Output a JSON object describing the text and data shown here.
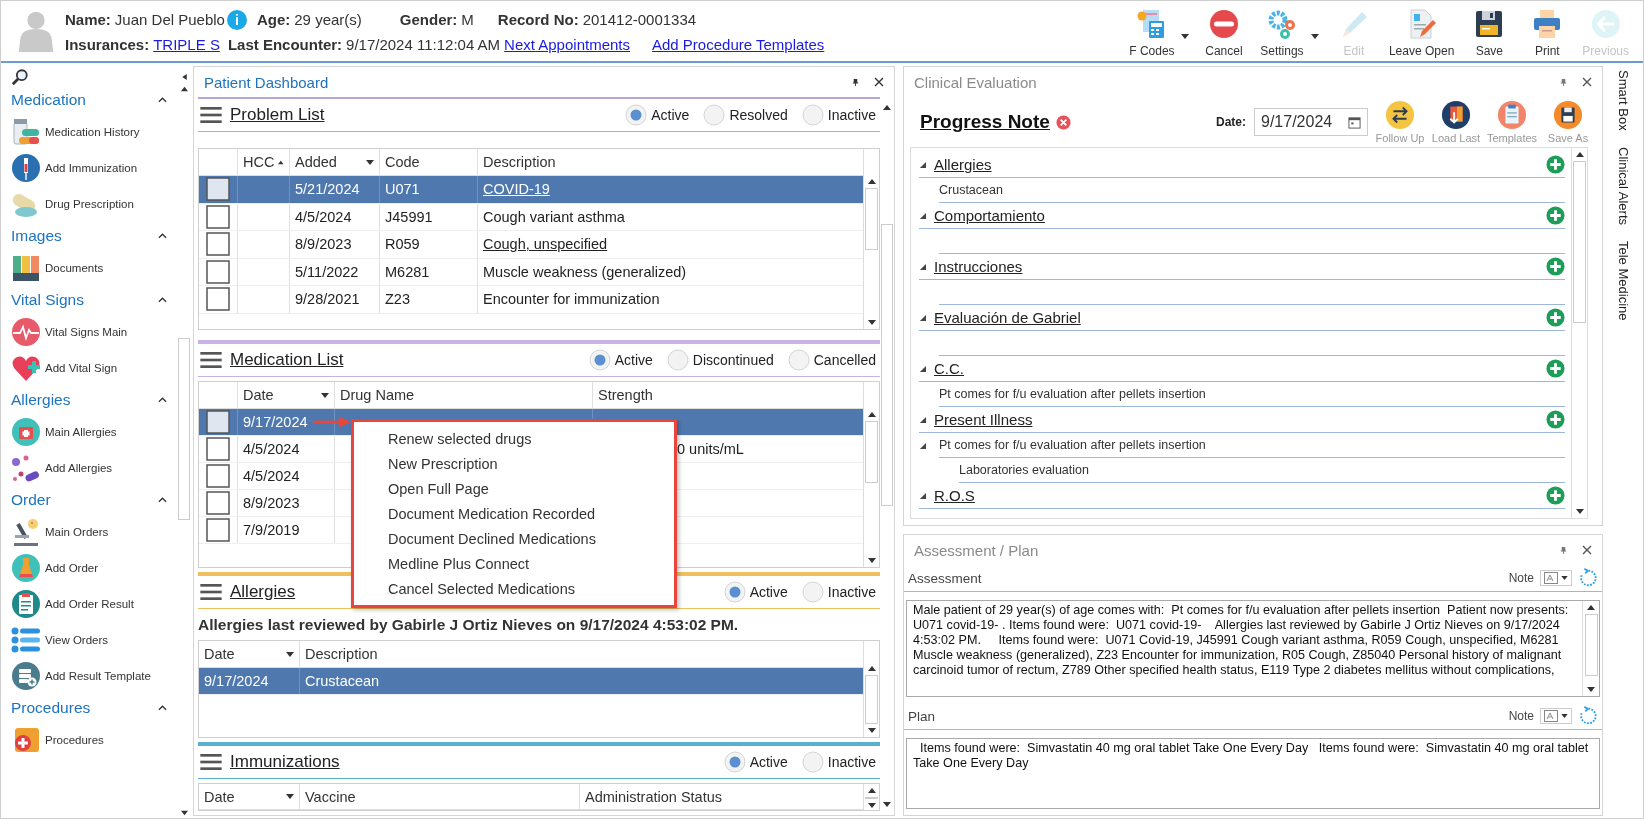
{
  "header": {
    "name_label": "Name:",
    "name": "Juan Del Pueblo",
    "info_icon": "i",
    "age_label": "Age:",
    "age": "29 year(s)",
    "gender_label": "Gender:",
    "gender": "M",
    "record_label": "Record No:",
    "record": "201412-0001334",
    "insurances_label": "Insurances:",
    "insurance": "TRIPLE S",
    "last_encounter_label": "Last Encounter:",
    "last_encounter": "9/17/2024 11:12:04 AM",
    "links": [
      "Next Appointments",
      "Add Procedure Templates"
    ]
  },
  "toolbar": [
    {
      "label": "F Codes",
      "kind": "fcodes",
      "dropdown": true,
      "disabled": false
    },
    {
      "label": "Cancel",
      "kind": "cancel",
      "dropdown": false,
      "disabled": false
    },
    {
      "label": "Settings",
      "kind": "settings",
      "dropdown": true,
      "disabled": false
    },
    {
      "label": "Edit",
      "kind": "edit",
      "dropdown": false,
      "disabled": true
    },
    {
      "label": "Leave Open",
      "kind": "leave",
      "dropdown": false,
      "disabled": false
    },
    {
      "label": "Save",
      "kind": "save",
      "dropdown": false,
      "disabled": false
    },
    {
      "label": "Print",
      "kind": "print",
      "dropdown": false,
      "disabled": false
    },
    {
      "label": "Previous",
      "kind": "previous",
      "dropdown": false,
      "disabled": true
    }
  ],
  "sidebar": {
    "sections": [
      {
        "title": "Medication",
        "expanded": true,
        "items": [
          {
            "label": "Medication History",
            "kind": "bottle"
          },
          {
            "label": "Add Immunization",
            "kind": "syringe"
          },
          {
            "label": "Drug Prescription",
            "kind": "capsule"
          }
        ]
      },
      {
        "title": "Images",
        "expanded": true,
        "items": [
          {
            "label": "Documents",
            "kind": "binders"
          }
        ]
      },
      {
        "title": "Vital Signs",
        "expanded": true,
        "items": [
          {
            "label": "Vital Signs Main",
            "kind": "pulse"
          },
          {
            "label": "Add Vital Sign",
            "kind": "heartplus"
          }
        ]
      },
      {
        "title": "Allergies",
        "expanded": true,
        "items": [
          {
            "label": "Main Allergies",
            "kind": "medkit"
          },
          {
            "label": "Add Allergies",
            "kind": "pills"
          }
        ]
      },
      {
        "title": "Order",
        "expanded": true,
        "items": [
          {
            "label": "Main Orders",
            "kind": "microscope"
          },
          {
            "label": "Add Order",
            "kind": "flask"
          },
          {
            "label": "Add Order Result",
            "kind": "clipboard"
          },
          {
            "label": "View Orders",
            "kind": "list"
          },
          {
            "label": "Add Result Template",
            "kind": "database"
          }
        ]
      },
      {
        "title": "Procedures",
        "expanded": true,
        "items": [
          {
            "label": "Procedures",
            "kind": "box"
          }
        ]
      }
    ]
  },
  "dashboard": {
    "title": "Patient Dashboard",
    "panels": [
      {
        "kind": "problems",
        "title": "Problem List",
        "color": "#b9a6d9",
        "filters": [
          {
            "label": "Active",
            "selected": true
          },
          {
            "label": "Resolved",
            "selected": false
          },
          {
            "label": "Inactive",
            "selected": false
          }
        ],
        "columns": [
          {
            "label": "HCC",
            "sort_up": true
          },
          {
            "label": "Added",
            "filter": true
          },
          {
            "label": "Code"
          },
          {
            "label": "Description"
          }
        ],
        "rows": [
          {
            "selected": true,
            "checked": false,
            "cells": [
              null,
              {
                "text": "5/21/2024"
              },
              {
                "text": "U071"
              },
              {
                "text": "COVID-19",
                "link": true
              }
            ]
          },
          {
            "selected": false,
            "checked": false,
            "cells": [
              null,
              {
                "text": "4/5/2024"
              },
              {
                "text": "J45991"
              },
              {
                "text": "Cough variant asthma"
              }
            ]
          },
          {
            "selected": false,
            "checked": false,
            "cells": [
              null,
              {
                "text": "8/9/2023"
              },
              {
                "text": "R059"
              },
              {
                "text": "Cough, unspecified",
                "link": true
              }
            ]
          },
          {
            "selected": false,
            "checked": false,
            "cells": [
              null,
              {
                "text": "5/11/2022"
              },
              {
                "text": "M6281"
              },
              {
                "text": "Muscle weakness (generalized)"
              }
            ]
          },
          {
            "selected": false,
            "checked": false,
            "cells": [
              null,
              {
                "text": "9/28/2021"
              },
              {
                "text": "Z23"
              },
              {
                "text": "Encounter for immunization"
              }
            ]
          }
        ]
      },
      {
        "kind": "medications",
        "title": "Medication List",
        "color": "#c9b3e6",
        "filters": [
          {
            "label": "Active",
            "selected": true
          },
          {
            "label": "Discontinued",
            "selected": false
          },
          {
            "label": "Cancelled",
            "selected": false
          }
        ],
        "columns": [
          {
            "label": "Date",
            "filter": true
          },
          {
            "label": "Drug Name"
          },
          {
            "label": "Strength"
          }
        ],
        "rows": [
          {
            "selected": true,
            "checked": false,
            "cells": [
              {
                "text": "9/17/2024"
              }
            ]
          },
          {
            "selected": false,
            "checked": false,
            "cells": [
              {
                "text": "4/5/2024"
              },
              null,
              {
                "text": "0 units/mL"
              }
            ]
          },
          {
            "selected": false,
            "checked": false,
            "cells": [
              {
                "text": "4/5/2024"
              }
            ]
          },
          {
            "selected": false,
            "checked": false,
            "cells": [
              {
                "text": "8/9/2023"
              }
            ]
          },
          {
            "selected": false,
            "checked": false,
            "cells": [
              {
                "text": "7/9/2019"
              }
            ]
          }
        ]
      },
      {
        "kind": "allergies",
        "title": "Allergies",
        "color": "#f0c060",
        "filters": [
          {
            "label": "Active",
            "selected": true
          },
          {
            "label": "Inactive",
            "selected": false
          }
        ],
        "note": "Allergies last reviewed by Gabirle J Ortiz Nieves on 9/17/2024 4:53:02 PM.",
        "columns": [
          {
            "label": "Date",
            "filter": true
          },
          {
            "label": "Description"
          }
        ],
        "rows": [
          {
            "selected": true,
            "cells": [
              {
                "text": "9/17/2024"
              },
              {
                "text": "Crustacean"
              }
            ]
          }
        ]
      },
      {
        "kind": "immunizations",
        "title": "Immunizations",
        "color": "#5aaed0",
        "filters": [
          {
            "label": "Active",
            "selected": true
          },
          {
            "label": "Inactive",
            "selected": false
          }
        ],
        "columns": [
          {
            "label": "Date",
            "filter": true
          },
          {
            "label": "Vaccine"
          },
          {
            "label": "Administration Status"
          }
        ]
      }
    ]
  },
  "context_menu": {
    "items": [
      "Renew selected drugs",
      "New Prescription",
      "Open Full Page",
      "Document Medication Recorded",
      "Document Declined Medications",
      "Medline Plus Connect",
      "Cancel Selected Medications"
    ]
  },
  "clinical": {
    "title": "Clinical Evaluation",
    "note_title": "Progress Note",
    "date_label": "Date:",
    "date": "9/17/2024",
    "actions": [
      {
        "label": "Follow Up",
        "kind": "follow"
      },
      {
        "label": "Load Last",
        "kind": "load"
      },
      {
        "label": "Templates",
        "kind": "templates"
      },
      {
        "label": "Save As",
        "kind": "saveas"
      }
    ],
    "sections": [
      {
        "title": "Allergies",
        "expanded": true,
        "items": [
          {
            "text": "Crustacean"
          }
        ]
      },
      {
        "title": "Comportamiento",
        "expanded": true
      },
      {
        "title": "Instrucciones",
        "expanded": true
      },
      {
        "title": "Evaluación de Gabriel",
        "expanded": true
      },
      {
        "title": "C.C.",
        "expanded": true,
        "items": [
          {
            "text": "Pt comes for f/u evaluation after pellets insertion"
          }
        ]
      },
      {
        "title": "Present Illness",
        "expanded": true,
        "items": [
          {
            "text": "Pt comes for f/u evaluation after pellets insertion",
            "expanded": true,
            "children": [
              {
                "text": "Laboratories evaluation"
              }
            ]
          }
        ]
      },
      {
        "title": "R.O.S",
        "expanded": true
      }
    ]
  },
  "assessment_plan": {
    "title": "Assessment / Plan",
    "fields": [
      {
        "label": "Assessment",
        "note_label": "Note",
        "text": "Male patient of 29 year(s) of age comes with:  Pt comes for f/u evaluation after pellets insertion  Patient now presents: U071 covid-19- . Items found were:  U071 covid-19-    Allergies last reviewed by Gabirle J Ortiz Nieves on 9/17/2024 4:53:02 PM.     Items found were:  U071 Covid-19, J45991 Cough variant asthma, R059 Cough, unspecified, M6281 Muscle weakness (generalized), Z23 Encounter for immunization, R05 Cough, Z85040 Personal history of malignant carcinoid tumor of rectum, Z789 Other specified health status, E119 Type 2 diabetes mellitus without complications,"
      },
      {
        "label": "Plan",
        "note_label": "Note",
        "text": "  Items found were:  Simvastatin 40 mg oral tablet Take One Every Day   Items found were:  Simvastatin 40 mg oral tablet Take One Every Day"
      }
    ]
  },
  "side_tabs": [
    "Smart Box",
    "Clinical Alerts",
    "Tele Medicine"
  ]
}
